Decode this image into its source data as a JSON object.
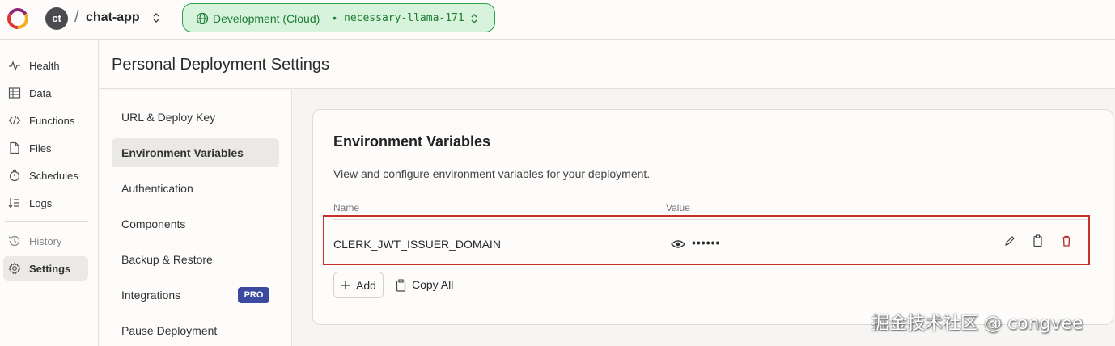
{
  "topbar": {
    "team_initials": "ct",
    "separator": "/",
    "project_name": "chat-app",
    "deployment": {
      "environment": "Development (Cloud)",
      "dot": "•",
      "name": "necessary-llama-171"
    }
  },
  "sidebar": {
    "items": [
      {
        "label": "Health",
        "icon": "health-icon"
      },
      {
        "label": "Data",
        "icon": "table-icon"
      },
      {
        "label": "Functions",
        "icon": "code-icon"
      },
      {
        "label": "Files",
        "icon": "file-icon"
      },
      {
        "label": "Schedules",
        "icon": "stopwatch-icon"
      },
      {
        "label": "Logs",
        "icon": "logs-icon"
      },
      {
        "label": "History",
        "icon": "history-icon"
      },
      {
        "label": "Settings",
        "icon": "gear-icon",
        "active": true
      }
    ]
  },
  "header": {
    "title": "Personal Deployment Settings"
  },
  "settings_nav": {
    "items": [
      {
        "label": "URL & Deploy Key"
      },
      {
        "label": "Environment Variables",
        "active": true
      },
      {
        "label": "Authentication"
      },
      {
        "label": "Components"
      },
      {
        "label": "Backup & Restore"
      },
      {
        "label": "Integrations",
        "badge": "PRO"
      },
      {
        "label": "Pause Deployment"
      }
    ]
  },
  "env_vars": {
    "title": "Environment Variables",
    "description": "View and configure environment variables for your deployment.",
    "columns": {
      "name": "Name",
      "value": "Value"
    },
    "rows": [
      {
        "name": "CLERK_JWT_ISSUER_DOMAIN",
        "value": "••••••"
      }
    ],
    "add_label": "Add",
    "copy_all_label": "Copy All"
  },
  "watermark": "掘金技术社区 @ congvee",
  "colors": {
    "accent_green": "#1d7d33",
    "pill_bg": "#d8f3dc",
    "pro_badge": "#3b4aa0",
    "highlight_border": "#c9302c",
    "delete_red": "#b3261e"
  }
}
